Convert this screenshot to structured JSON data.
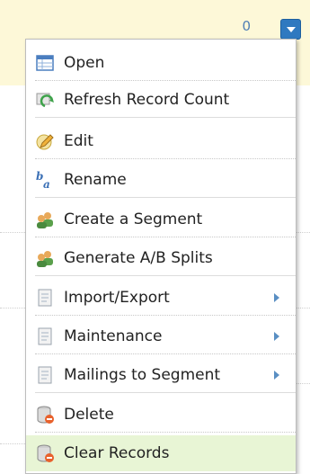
{
  "header": {
    "count": "0"
  },
  "menu": {
    "items": [
      {
        "label": "Open",
        "icon": "table-icon"
      },
      {
        "label": "Refresh Record Count",
        "icon": "refresh-icon"
      },
      {
        "label": "Edit",
        "icon": "pencil-icon"
      },
      {
        "label": "Rename",
        "icon": "rename-icon"
      },
      {
        "label": "Create a Segment",
        "icon": "users-icon"
      },
      {
        "label": "Generate A/B Splits",
        "icon": "users-icon"
      },
      {
        "label": "Import/Export",
        "icon": "document-icon",
        "submenu": true
      },
      {
        "label": "Maintenance",
        "icon": "document-icon",
        "submenu": true
      },
      {
        "label": "Mailings to Segment",
        "icon": "document-icon",
        "submenu": true
      },
      {
        "label": "Delete",
        "icon": "delete-icon"
      },
      {
        "label": "Clear Records",
        "icon": "clear-icon"
      }
    ]
  },
  "colors": {
    "accent": "#2f79c0",
    "highlight": "#e8f5d5",
    "band": "#fdf8d8"
  }
}
